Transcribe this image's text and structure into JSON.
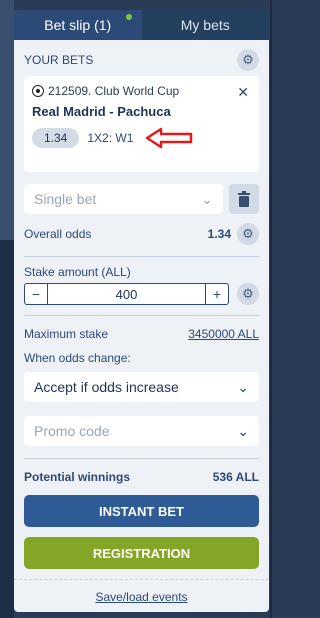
{
  "tabs": {
    "bet_slip": "Bet slip (1)",
    "my_bets": "My bets"
  },
  "your_bets": {
    "label": "YOUR BETS",
    "card": {
      "event": "212509. Club World Cup",
      "match": "Real Madrid - Pachuca",
      "odds": "1.34",
      "market": "1X2: W1"
    }
  },
  "bet_type": {
    "selected": "Single bet"
  },
  "overall_odds": {
    "label": "Overall odds",
    "value": "1.34"
  },
  "stake": {
    "label": "Stake amount (ALL)",
    "minus": "−",
    "value": "400",
    "plus": "+"
  },
  "maximum_stake": {
    "label": "Maximum stake",
    "value": "3450000 ALL"
  },
  "odds_change": {
    "label": "When odds change:",
    "selected": "Accept if odds increase"
  },
  "promo": {
    "placeholder": "Promo code"
  },
  "potential_winnings": {
    "label": "Potential winnings",
    "value": "536 ALL"
  },
  "buttons": {
    "instant_bet": "INSTANT BET",
    "registration": "REGISTRATION"
  },
  "footer": {
    "save_load": "Save/load events"
  },
  "colors": {
    "accent": "#2c4a77",
    "instant_bet": "#2e5b95",
    "registration": "#84a626",
    "notification_dot": "#7ac943",
    "annotation_arrow": "#e01b1b"
  }
}
